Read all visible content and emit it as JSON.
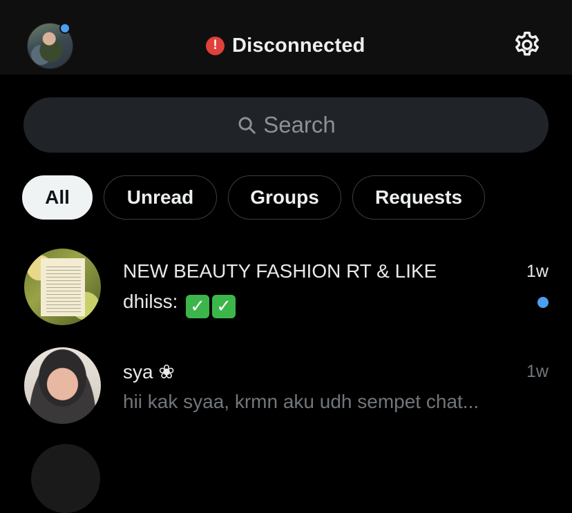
{
  "header": {
    "status_text": "Disconnected",
    "status_icon": "alert-icon",
    "status_color": "#e0413a",
    "settings_icon": "gear-icon",
    "avatar_has_notification": true
  },
  "search": {
    "placeholder": "Search"
  },
  "filters": [
    {
      "label": "All",
      "active": true
    },
    {
      "label": "Unread",
      "active": false
    },
    {
      "label": "Groups",
      "active": false
    },
    {
      "label": "Requests",
      "active": false
    }
  ],
  "conversations": [
    {
      "name": "NEW BEAUTY FASHION RT & LIKE",
      "preview_sender": "dhilss:",
      "preview_emoji": [
        "check-mark-icon",
        "check-mark-icon"
      ],
      "time": "1w",
      "unread": true
    },
    {
      "name": "sya ❀",
      "preview": "hii kak syaa, krmn aku udh sempet chat...",
      "time": "1w",
      "unread": false
    }
  ],
  "colors": {
    "accent": "#4c9ef0",
    "background": "#000000",
    "header_bg": "#0f0f10",
    "search_bg": "#202327",
    "muted_text": "#71767b"
  }
}
